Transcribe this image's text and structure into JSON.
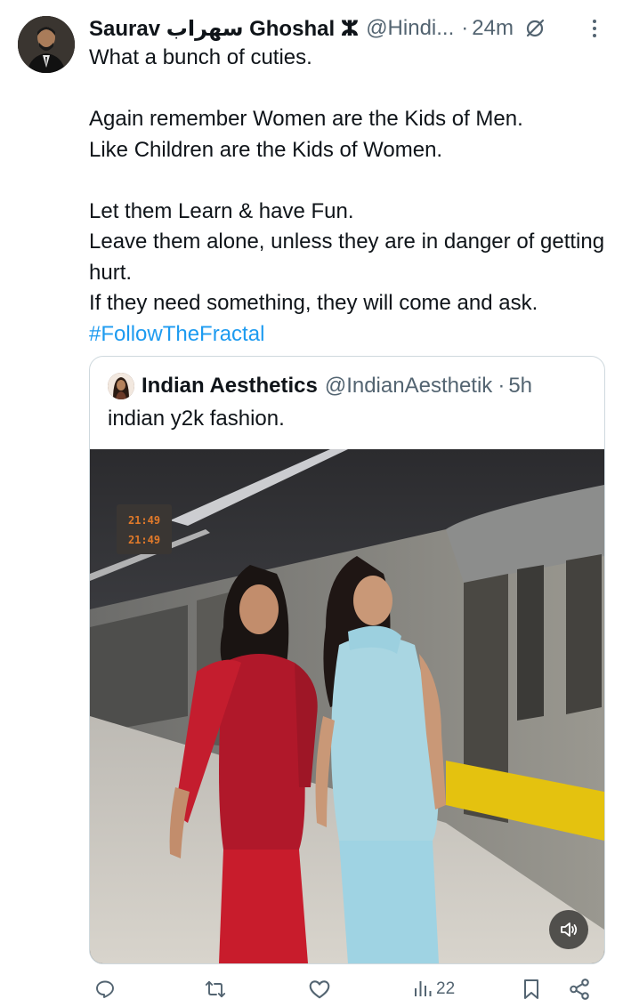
{
  "tweet": {
    "author_name": "Saurav سهراب Ghoshal ⵣ",
    "handle": "@Hindi...",
    "dot": "·",
    "time": "24m",
    "body_lines": [
      "What a bunch of cuties.",
      "",
      "Again remember Women are the Kids of Men.",
      "Like Children are the Kids of Women.",
      "",
      "Let them Learn & have Fun.",
      "Leave them alone, unless they are in danger of getting hurt.",
      "If they need something, they will come and ask."
    ],
    "hashtag": "#FollowTheFractal"
  },
  "quote": {
    "author_name": "Indian Aesthetics",
    "handle": "@IndianAesthetik",
    "dot": "·",
    "time": "5h",
    "text": "indian y2k fashion.",
    "media": {
      "platform_display": [
        "21:49",
        "21:49"
      ],
      "icon": "speaker-icon"
    }
  },
  "actions": {
    "reply_icon": "reply-icon",
    "retweet_icon": "retweet-icon",
    "like_icon": "heart-icon",
    "views_icon": "views-icon",
    "views_count": "22",
    "bookmark_icon": "bookmark-icon",
    "share_icon": "share-icon"
  },
  "colors": {
    "text": "#0f1419",
    "secondary": "#536471",
    "link": "#1d9bf0",
    "border": "#cfd9de"
  }
}
